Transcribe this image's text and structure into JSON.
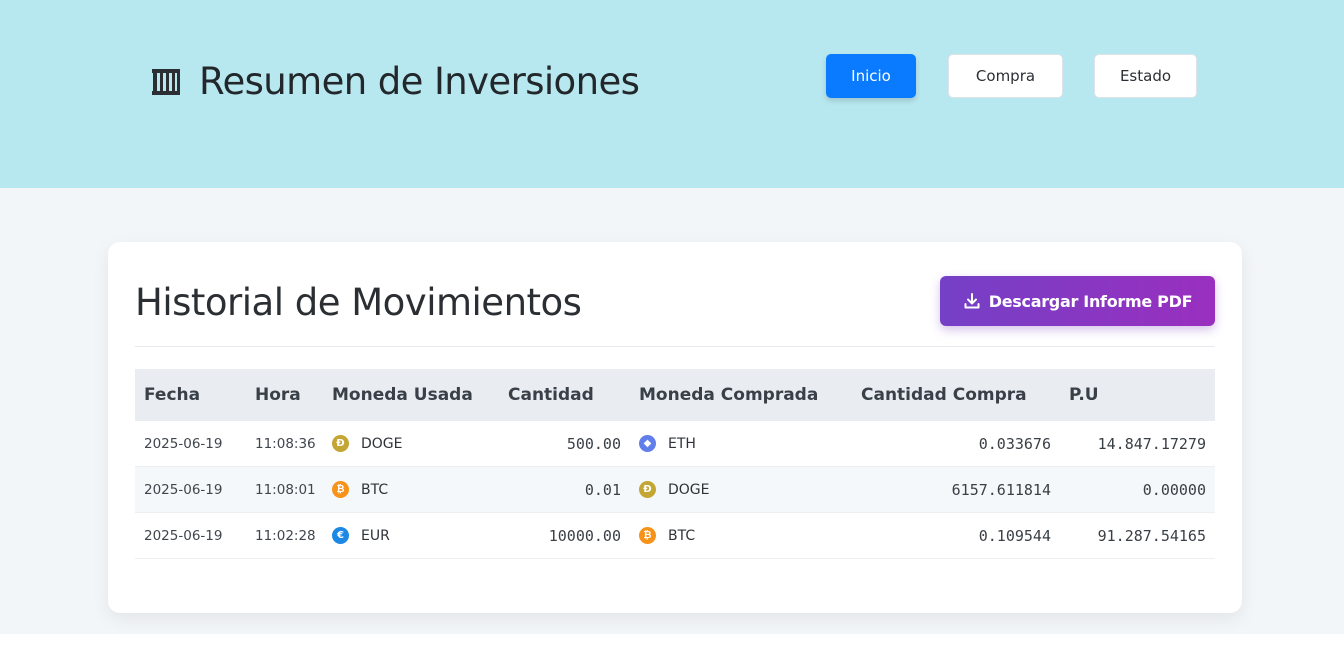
{
  "header": {
    "title": "Resumen de Inversiones",
    "nav": [
      {
        "label": "Inicio",
        "active": true
      },
      {
        "label": "Compra",
        "active": false
      },
      {
        "label": "Estado",
        "active": false
      }
    ],
    "bg_color": "#b8e8ef",
    "accent_color": "#0a7bff"
  },
  "card": {
    "title": "Historial de Movimientos",
    "download_label": "Descargar Informe PDF",
    "download_icon": "download-icon",
    "download_colors": [
      "#7440c6",
      "#9a2fbf"
    ]
  },
  "table": {
    "columns": [
      "Fecha",
      "Hora",
      "Moneda Usada",
      "Cantidad",
      "Moneda Comprada",
      "Cantidad Compra",
      "P.U"
    ],
    "rows": [
      {
        "fecha": "2025-06-19",
        "hora": "11:08:36",
        "moneda_usada": "DOGE",
        "cantidad": "500.00",
        "moneda_comprada": "ETH",
        "cantidad_compra": "0.033676",
        "pu": "14.847.17279"
      },
      {
        "fecha": "2025-06-19",
        "hora": "11:08:01",
        "moneda_usada": "BTC",
        "cantidad": "0.01",
        "moneda_comprada": "DOGE",
        "cantidad_compra": "6157.611814",
        "pu": "0.00000"
      },
      {
        "fecha": "2025-06-19",
        "hora": "11:02:28",
        "moneda_usada": "EUR",
        "cantidad": "10000.00",
        "moneda_comprada": "BTC",
        "cantidad_compra": "0.109544",
        "pu": "91.287.54165"
      }
    ],
    "coin_icons": {
      "DOGE": {
        "glyph": "Ð",
        "color": "#c3a634"
      },
      "BTC": {
        "glyph": "₿",
        "color": "#f7931a"
      },
      "ETH": {
        "glyph": "◆",
        "color": "#627eea"
      },
      "EUR": {
        "glyph": "€",
        "color": "#1e88e5"
      }
    }
  }
}
